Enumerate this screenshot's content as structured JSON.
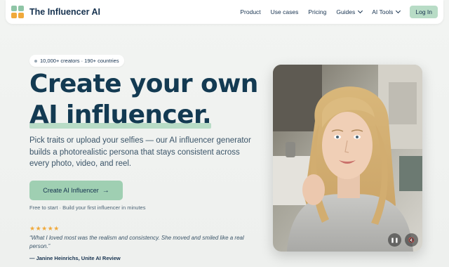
{
  "brand": {
    "name": "The Influencer AI"
  },
  "nav": {
    "links": [
      {
        "label": "Product"
      },
      {
        "label": "Use cases"
      },
      {
        "label": "Pricing"
      },
      {
        "label": "Guides"
      },
      {
        "label": "AI Tools"
      }
    ],
    "login": "Log In"
  },
  "hero": {
    "badge": "10,000+ creators · 190+ countries",
    "headline_line1": "Create your own",
    "headline_line2": "AI influencer.",
    "subtext": "Pick traits or upload your selfies — our AI influencer generator builds a photorealistic persona that stays consistent across every photo, video, and reel.",
    "cta_label": "Create AI Influencer",
    "cta_arrow": "→",
    "cta_note": "Free to start · Build your first influencer in minutes",
    "rating_stars": "★★★★★",
    "quote": "“What I loved most was the realism and consistency. She moved and smiled like a real person.”",
    "quote_author": "— Janine Heinrichs, Unite AI Review"
  },
  "video": {
    "pause_icon": "pause-icon",
    "mute_icon": "mute-icon"
  },
  "colors": {
    "navy": "#133a52",
    "mint": "#9fcfb2",
    "mint_light": "#b8dcc6",
    "amber": "#f0a93b"
  }
}
